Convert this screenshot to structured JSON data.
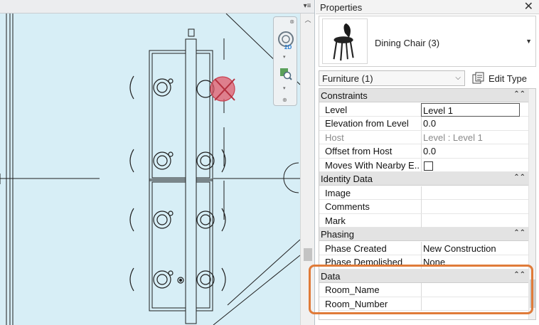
{
  "viewport": {
    "menu_icon": "dropdown-arrow-icon",
    "scroll_up_icon": "chevron-up-icon",
    "navigation_bar": {
      "close_glyph": "⊗",
      "two_d_label": "2D",
      "bottom_glyph": "⊕"
    },
    "colors": {
      "background": "#d7eef6",
      "linework": "#1e1e1e",
      "selected_marker": "#e05a6a"
    }
  },
  "properties": {
    "title": "Properties",
    "close_label": "✕",
    "type_selector": {
      "name": "Dining Chair (3)",
      "thumbnail_icon": "dining-chair-icon"
    },
    "filter": {
      "value": "Furniture (1)",
      "edit_type_label": "Edit Type",
      "edit_type_icon": "edit-type-icon"
    },
    "groups": [
      {
        "label": "Constraints",
        "collapse": "⌃⌃",
        "rows": [
          {
            "name": "Level",
            "value": "Level 1",
            "editing": true
          },
          {
            "name": "Elevation from Level",
            "value": "0.0"
          },
          {
            "name": "Host",
            "value": "Level : Level 1",
            "disabled": true
          },
          {
            "name": "Offset from Host",
            "value": "0.0"
          },
          {
            "name": "Moves With Nearby E...",
            "value": "",
            "checkbox": true,
            "checked": false
          }
        ]
      },
      {
        "label": "Identity Data",
        "collapse": "⌃⌃",
        "rows": [
          {
            "name": "Image",
            "value": ""
          },
          {
            "name": "Comments",
            "value": ""
          },
          {
            "name": "Mark",
            "value": ""
          }
        ]
      },
      {
        "label": "Phasing",
        "collapse": "⌃⌃",
        "rows": [
          {
            "name": "Phase Created",
            "value": "New Construction"
          },
          {
            "name": "Phase Demolished",
            "value": "None"
          }
        ]
      },
      {
        "label": "Data",
        "collapse": "⌃⌃",
        "rows": [
          {
            "name": "Room_Name",
            "value": ""
          },
          {
            "name": "Room_Number",
            "value": ""
          }
        ]
      }
    ],
    "highlight_color": "#e07b39"
  }
}
